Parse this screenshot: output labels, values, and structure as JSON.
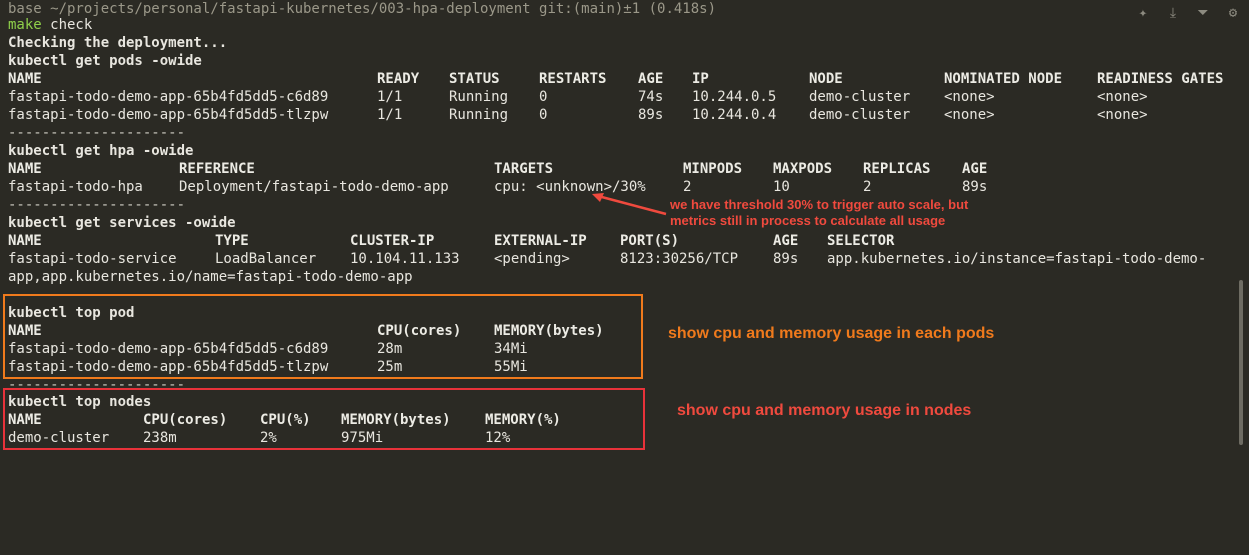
{
  "prompt": {
    "line": "base ~/projects/personal/fastapi-kubernetes/003-hpa-deployment git:(main)±1 (0.418s)",
    "command": "make",
    "command_arg": " check"
  },
  "checking": "Checking the deployment...",
  "separator": "---------------------",
  "pods": {
    "cmd": "kubectl get pods -owide",
    "headers": [
      "NAME",
      "READY",
      "STATUS",
      "RESTARTS",
      "AGE",
      "IP",
      "NODE",
      "NOMINATED NODE",
      "READINESS GATES"
    ],
    "rows": [
      [
        "fastapi-todo-demo-app-65b4fd5dd5-c6d89",
        "1/1",
        "Running",
        "0",
        "74s",
        "10.244.0.5",
        "demo-cluster",
        "<none>",
        "<none>"
      ],
      [
        "fastapi-todo-demo-app-65b4fd5dd5-tlzpw",
        "1/1",
        "Running",
        "0",
        "89s",
        "10.244.0.4",
        "demo-cluster",
        "<none>",
        "<none>"
      ]
    ]
  },
  "hpa": {
    "cmd": "kubectl get hpa -owide",
    "headers": [
      "NAME",
      "REFERENCE",
      "TARGETS",
      "MINPODS",
      "MAXPODS",
      "REPLICAS",
      "AGE"
    ],
    "rows": [
      [
        "fastapi-todo-hpa",
        "Deployment/fastapi-todo-demo-app",
        "cpu: <unknown>/30%",
        "2",
        "10",
        "2",
        "89s"
      ]
    ]
  },
  "services": {
    "cmd": "kubectl get services -owide",
    "headers": [
      "NAME",
      "TYPE",
      "CLUSTER-IP",
      "EXTERNAL-IP",
      "PORT(S)",
      "AGE",
      "SELECTOR"
    ],
    "rows": [
      [
        "fastapi-todo-service",
        "LoadBalancer",
        "10.104.11.133",
        "<pending>",
        "8123:30256/TCP",
        "89s",
        "app.kubernetes.io/instance=fastapi-todo-demo-"
      ]
    ],
    "wrap": "app,app.kubernetes.io/name=fastapi-todo-demo-app"
  },
  "top_pod": {
    "cmd": "kubectl top pod",
    "headers": [
      "NAME",
      "CPU(cores)",
      "MEMORY(bytes)"
    ],
    "rows": [
      [
        "fastapi-todo-demo-app-65b4fd5dd5-c6d89",
        "28m",
        "34Mi"
      ],
      [
        "fastapi-todo-demo-app-65b4fd5dd5-tlzpw",
        "25m",
        "55Mi"
      ]
    ]
  },
  "top_nodes": {
    "cmd": "kubectl top nodes",
    "headers": [
      "NAME",
      "CPU(cores)",
      "CPU(%)",
      "MEMORY(bytes)",
      "MEMORY(%)"
    ],
    "rows": [
      [
        "demo-cluster",
        "238m",
        "2%",
        "975Mi",
        "12%"
      ]
    ]
  },
  "annotations": {
    "hpa_note_1": "we have threshold 30% to trigger auto scale, but",
    "hpa_note_2": "metrics still in process to calculate all usage",
    "pod_note": "show cpu and memory usage in each pods",
    "nodes_note": "show cpu and memory usage in nodes"
  },
  "colors": {
    "background": "#2b2a24",
    "command": "#8fd04a",
    "annotation_red": "#f04a3e",
    "annotation_orange": "#f07a1c"
  },
  "toolbar_icons": [
    "pin-icon",
    "download-icon",
    "filter-icon",
    "settings-icon"
  ]
}
